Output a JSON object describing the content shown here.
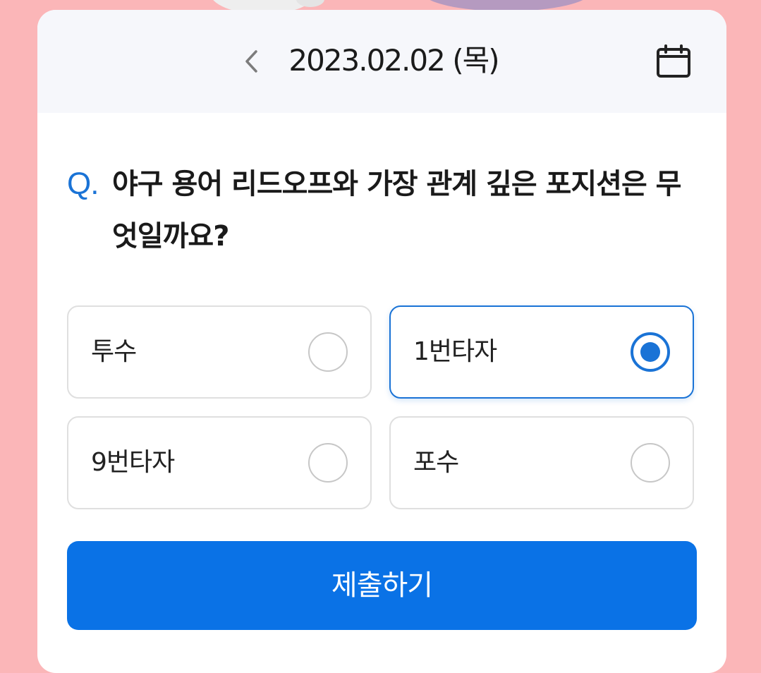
{
  "colors": {
    "accent": "#1a73d6",
    "submit_bg": "#0a72e6",
    "page_bg": "#fbb6b8",
    "header_bg": "#f6f7fb"
  },
  "header": {
    "date": "2023.02.02 (목)",
    "prev_icon": "chevron-left-icon",
    "calendar_icon": "calendar-icon"
  },
  "question": {
    "prefix": "Q.",
    "text": "야구 용어 리드오프와 가장 관계 깊은 포지션은 무엇일까요?"
  },
  "options": [
    {
      "label": "투수",
      "selected": false
    },
    {
      "label": "1번타자",
      "selected": true
    },
    {
      "label": "9번타자",
      "selected": false
    },
    {
      "label": "포수",
      "selected": false
    }
  ],
  "submit": {
    "label": "제출하기"
  }
}
